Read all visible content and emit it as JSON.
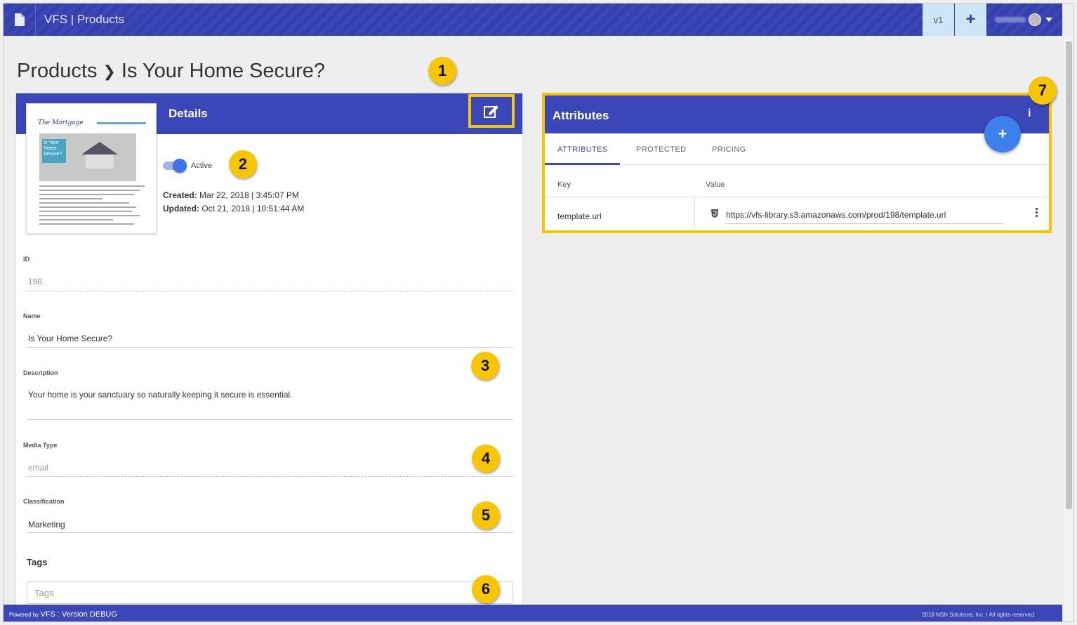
{
  "nav": {
    "app_title": "VFS | Products",
    "version": "v1",
    "add_label": "+",
    "icons": {
      "doc": "document-icon",
      "avatar": "avatar-icon",
      "caret": "caret-down-icon"
    }
  },
  "breadcrumb": {
    "root": "Products",
    "separator": "❯",
    "current": "Is Your Home Secure?"
  },
  "markers": [
    "1",
    "2",
    "3",
    "4",
    "5",
    "6",
    "7"
  ],
  "details": {
    "title": "Details",
    "thumbnail": {
      "logo": "The Mortgage",
      "headline": "Is Your Home Secure?"
    },
    "active_label": "Active",
    "active": true,
    "created_label": "Created:",
    "created_value": "Mar 22, 2018 | 3:45:07 PM",
    "updated_label": "Updated:",
    "updated_value": "Oct 21, 2018 | 10:51:44 AM",
    "fields": {
      "id": {
        "label": "ID",
        "value": "198"
      },
      "name": {
        "label": "Name",
        "value": "Is Your Home Secure?"
      },
      "description": {
        "label": "Description",
        "value": "Your home is your sanctuary so naturally keeping it secure is essential."
      },
      "media_type": {
        "label": "Media Type",
        "value": "email"
      },
      "classification": {
        "label": "Classification",
        "value": "Marketing"
      }
    },
    "tags_heading": "Tags",
    "tags_placeholder": "Tags"
  },
  "attributes": {
    "title": "Attributes",
    "info_icon": "i",
    "add_label": "+",
    "tabs": [
      "ATTRIBUTES",
      "PROTECTED",
      "PRICING"
    ],
    "active_tab": "ATTRIBUTES",
    "columns": {
      "key": "Key",
      "value": "Value"
    },
    "rows": [
      {
        "key": "template.url",
        "value": "https://vfs-library.s3.amazonaws.com/prod/198/template.url"
      }
    ]
  },
  "footer": {
    "powered_by": "Powered by",
    "version_text": "VFS : Version DEBUG",
    "copyright": "2018 NSN Solutions, Inc. | All rights reserved."
  },
  "colors": {
    "primary": "#3b46b8",
    "highlight": "#f7c600",
    "fab": "#3d80ec",
    "nav_light": "#cfe6f7"
  }
}
